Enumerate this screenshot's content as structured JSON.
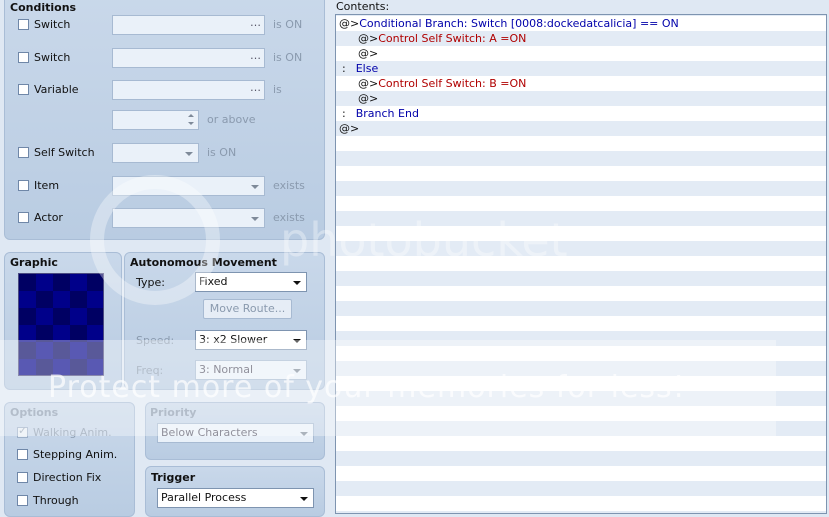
{
  "conditions": {
    "title": "Conditions",
    "rows": [
      {
        "label": "Switch",
        "value": "",
        "suffix": "is ON"
      },
      {
        "label": "Switch",
        "value": "",
        "suffix": "is ON"
      },
      {
        "label": "Variable",
        "value": "",
        "suffix": "is"
      },
      {
        "label": "",
        "value": "",
        "suffix": "or above"
      },
      {
        "label": "Self Switch",
        "value": "",
        "suffix": "is ON"
      },
      {
        "label": "Item",
        "value": "",
        "suffix": "exists"
      },
      {
        "label": "Actor",
        "value": "",
        "suffix": "exists"
      }
    ]
  },
  "graphic": {
    "title": "Graphic"
  },
  "autonomous": {
    "title": "Autonomous Movement",
    "type_label": "Type:",
    "type_value": "Fixed",
    "move_route_label": "Move Route...",
    "speed_label": "Speed:",
    "speed_value": "3: x2 Slower",
    "freq_label": "Freq:",
    "freq_value": "3: Normal"
  },
  "options": {
    "title": "Options",
    "items": [
      {
        "label": "Walking Anim.",
        "checked": true,
        "disabled": true
      },
      {
        "label": "Stepping Anim.",
        "checked": false,
        "disabled": false
      },
      {
        "label": "Direction Fix",
        "checked": false,
        "disabled": false
      },
      {
        "label": "Through",
        "checked": false,
        "disabled": false
      }
    ]
  },
  "priority": {
    "title": "Priority",
    "value": "Below Characters"
  },
  "trigger": {
    "title": "Trigger",
    "value": "Parallel Process"
  },
  "contents": {
    "title": "Contents:",
    "lines": [
      {
        "prefix": "@>",
        "text": "Conditional Branch: Switch [0008:dockedatcalicia] == ON",
        "color": "blue",
        "indent": 0
      },
      {
        "prefix": "@>",
        "text": "Control Self Switch: A =ON",
        "color": "red",
        "indent": 1
      },
      {
        "prefix": "@>",
        "text": "",
        "color": "blue",
        "indent": 1
      },
      {
        "prefix": ":",
        "text": "Else",
        "color": "blue",
        "indent": 0
      },
      {
        "prefix": "@>",
        "text": "Control Self Switch: B =ON",
        "color": "red",
        "indent": 1
      },
      {
        "prefix": "@>",
        "text": "",
        "color": "blue",
        "indent": 1
      },
      {
        "prefix": ":",
        "text": "Branch End",
        "color": "blue",
        "indent": 0
      },
      {
        "prefix": "@>",
        "text": "",
        "color": "blue",
        "indent": 0
      }
    ]
  },
  "watermark": {
    "logo_text": "photobucket",
    "tagline": "Protect more of your memories for less!"
  }
}
